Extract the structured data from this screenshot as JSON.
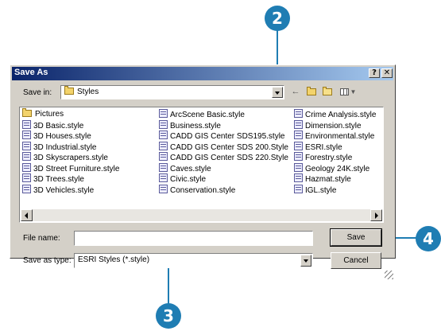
{
  "callouts": [
    "2",
    "3",
    "4"
  ],
  "dialog": {
    "title": "Save As",
    "help_btn": "?",
    "close_btn": "✕",
    "save_in_label": "Save in:",
    "save_in_value": "Styles",
    "toolbar_icons": [
      "back-icon",
      "up-folder-icon",
      "new-folder-icon",
      "views-menu-icon"
    ],
    "files": {
      "col1": [
        "Pictures",
        "3D Basic.style",
        "3D Houses.style",
        "3D Industrial.style",
        "3D Skyscrapers.style",
        "3D Street Furniture.style",
        "3D Trees.style",
        "3D Vehicles.style"
      ],
      "col2": [
        "ArcScene Basic.style",
        "Business.style",
        "CADD GIS Center SDS195.style",
        "CADD GIS Center SDS 200.Style",
        "CADD GIS Center SDS 220.Style",
        "Caves.style",
        "Civic.style",
        "Conservation.style"
      ],
      "col3": [
        "Crime Analysis.style",
        "Dimension.style",
        "Environmental.style",
        "ESRI.style",
        "Forestry.style",
        "Geology 24K.style",
        "Hazmat.style",
        "IGL.style"
      ]
    },
    "file_name_label": "File name:",
    "file_name_value": "",
    "save_as_type_label": "Save as type:",
    "save_as_type_value": "ESRI Styles (*.style)",
    "save_button": "Save",
    "cancel_button": "Cancel"
  },
  "colors": {
    "callout": "#1f7db3",
    "titlebar": "#0a246a",
    "dialog_bg": "#d4d0c8"
  }
}
